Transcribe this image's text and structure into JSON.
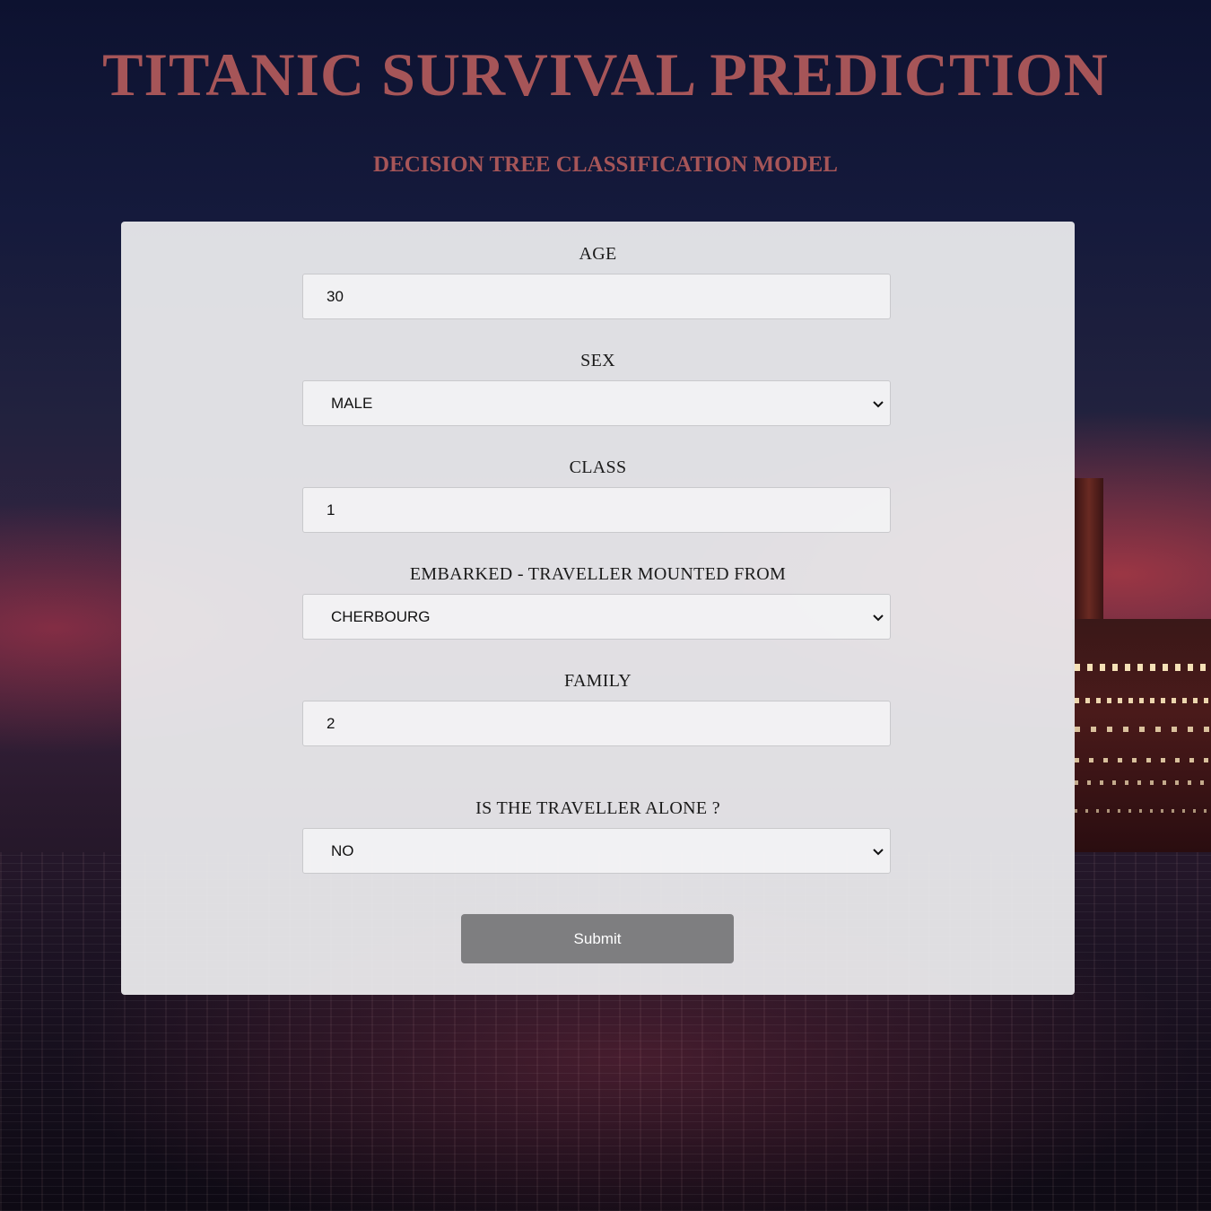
{
  "page": {
    "title": "TITANIC SURVIVAL PREDICTION",
    "subtitle": "DECISION TREE CLASSIFICATION MODEL"
  },
  "colors": {
    "title": "#a65558",
    "card": "#eeeef0",
    "submit_bg": "#7e7e80",
    "submit_text": "#ffffff"
  },
  "form": {
    "age": {
      "label": "AGE",
      "value": "30"
    },
    "sex": {
      "label": "SEX",
      "value": "MALE",
      "icon": "chevron-down-icon"
    },
    "class": {
      "label": "CLASS",
      "value": "1"
    },
    "embarked": {
      "label": "EMBARKED - TRAVELLER MOUNTED FROM",
      "value": "CHERBOURG",
      "icon": "chevron-down-icon"
    },
    "family": {
      "label": "FAMILY",
      "value": "2"
    },
    "alone": {
      "label": "IS THE TRAVELLER ALONE ?",
      "value": "NO",
      "icon": "chevron-down-icon"
    },
    "submit_label": "Submit"
  }
}
